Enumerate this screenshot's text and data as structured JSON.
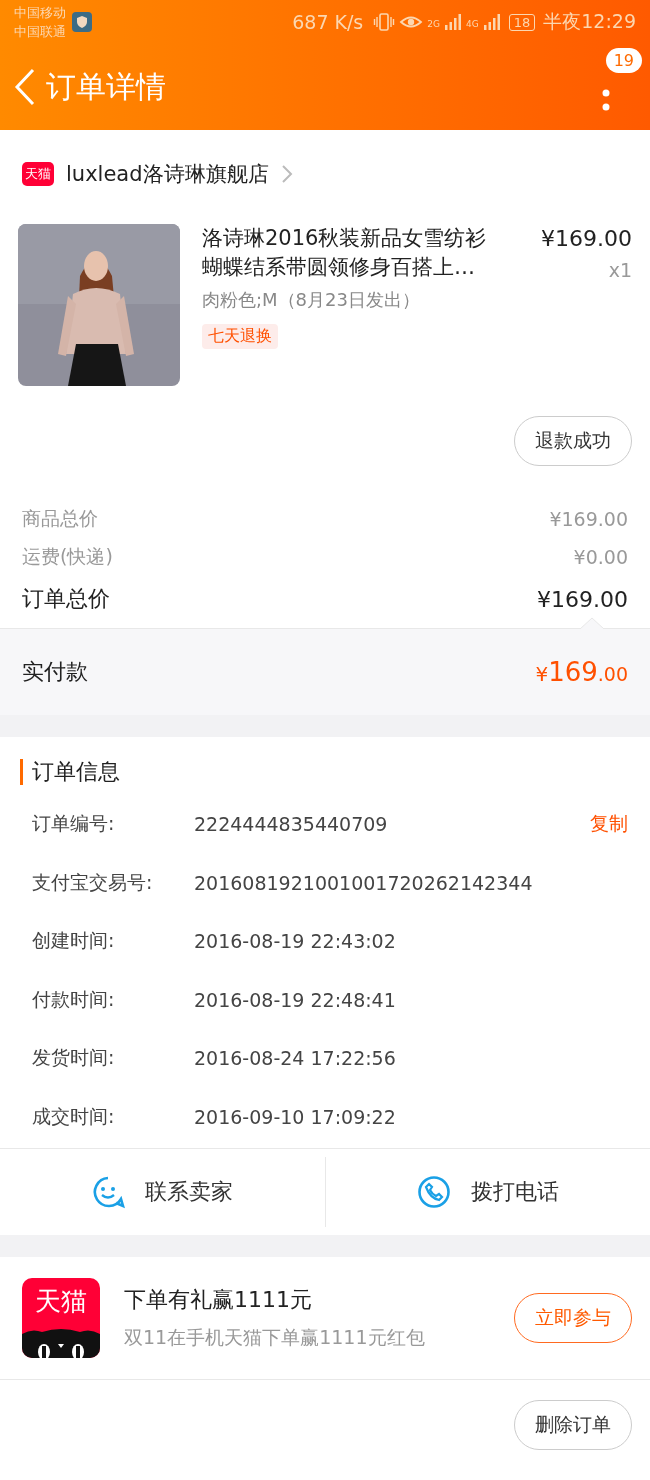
{
  "status_bar": {
    "carriers": [
      "中国移动",
      "中国联通"
    ],
    "speed": "687 K/s",
    "network_labels": [
      "2G",
      "4G"
    ],
    "battery": "18",
    "time": "半夜12:29"
  },
  "header": {
    "title": "订单详情",
    "badge": "19"
  },
  "store": {
    "logo": "天猫",
    "name": "luxlead洛诗琳旗舰店"
  },
  "product": {
    "kind": "picture",
    "title": "洛诗琳2016秋装新品女雪纺衫蝴蝶结系带圆领修身百搭上…",
    "price": "¥169.00",
    "quantity": "x1",
    "sku": "肉粉色;M（8月23日发出）",
    "tag": "七天退换",
    "status_button": "退款成功"
  },
  "summary": [
    {
      "label": "商品总价",
      "value": "¥169.00",
      "kind": "minor"
    },
    {
      "label": "运费(快递)",
      "value": "¥0.00",
      "kind": "minor"
    },
    {
      "label": "订单总价",
      "value": "¥169.00",
      "kind": "major"
    }
  ],
  "paid": {
    "label": "实付款",
    "currency": "¥",
    "integer": "169",
    "decimal": ".00"
  },
  "order_info": {
    "title": "订单信息",
    "rows": [
      {
        "label": "订单编号:",
        "value": "2224444835440709",
        "action": "复制"
      },
      {
        "label": "支付宝交易号:",
        "value": "2016081921001001720262142344"
      },
      {
        "label": "创建时间:",
        "value": "2016-08-19 22:43:02"
      },
      {
        "label": "付款时间:",
        "value": "2016-08-19 22:48:41"
      },
      {
        "label": "发货时间:",
        "value": "2016-08-24 17:22:56"
      },
      {
        "label": "成交时间:",
        "value": "2016-09-10 17:09:22"
      }
    ]
  },
  "contact": [
    {
      "label": "联系卖家",
      "kind": "chat"
    },
    {
      "label": "拨打电话",
      "kind": "phone"
    }
  ],
  "promo": {
    "logo": "天猫",
    "title": "下单有礼赢1111元",
    "subtitle": "双11在手机天猫下单赢1111元红包",
    "button": "立即参与"
  },
  "footer": {
    "button": "删除订单"
  }
}
